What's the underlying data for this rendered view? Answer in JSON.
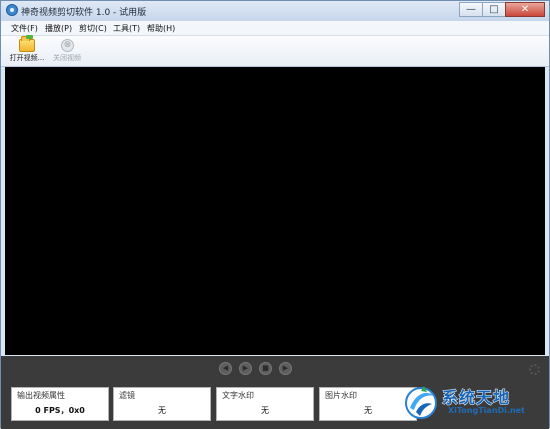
{
  "window": {
    "title": "神奇视频剪切软件 1.0 - 试用版",
    "controls": {
      "minimize": "—",
      "maximize": "□",
      "close": "✕"
    }
  },
  "menubar": {
    "items": [
      {
        "label": "文件(F)"
      },
      {
        "label": "播放(P)"
      },
      {
        "label": "剪切(C)"
      },
      {
        "label": "工具(T)"
      },
      {
        "label": "帮助(H)"
      }
    ]
  },
  "toolbar": {
    "open_label": "打开视频...",
    "close_label": "关闭视频",
    "close_glyph": "⊗"
  },
  "playback": {
    "glyphs": [
      "◀",
      "▶",
      "■",
      "▶"
    ]
  },
  "panels": [
    {
      "title": "输出视频属性",
      "value": "0 FPS，0x0"
    },
    {
      "title": "滤镜",
      "value": "无"
    },
    {
      "title": "文字水印",
      "value": "无"
    },
    {
      "title": "图片水印",
      "value": "无"
    }
  ],
  "watermark": {
    "main": "系统天地",
    "sub": "XiTongTianDi.net"
  },
  "colors": {
    "video_bg": "#000000",
    "bottom_bar": "#3b3b3b",
    "brand_blue": "#1765b8"
  }
}
